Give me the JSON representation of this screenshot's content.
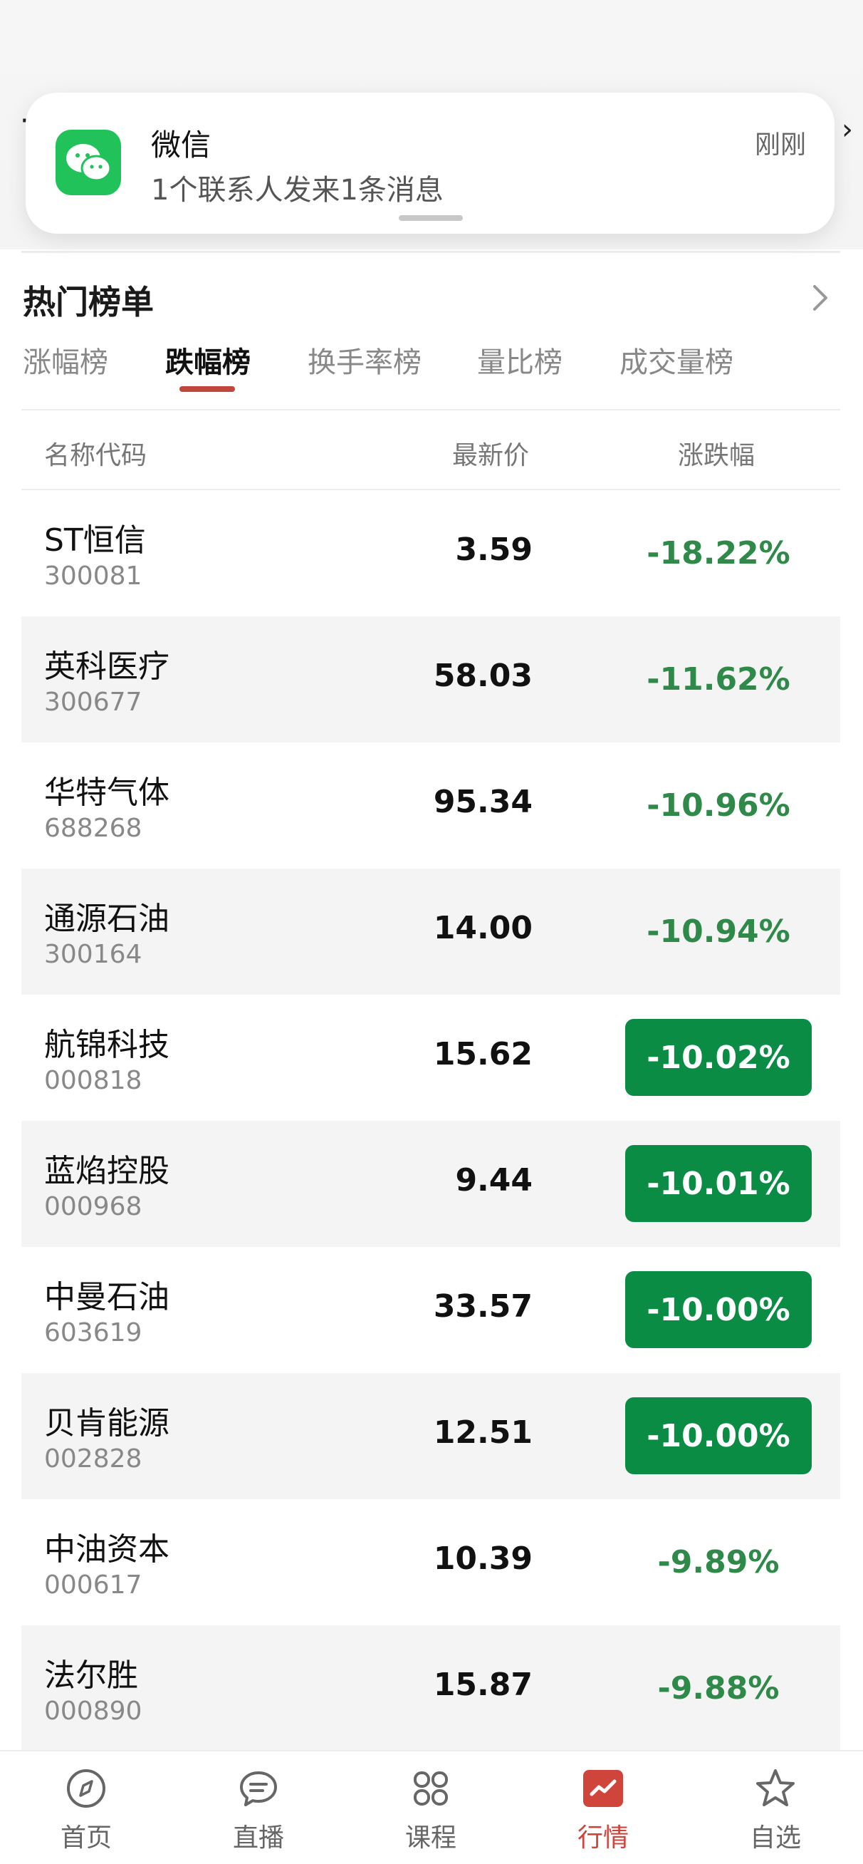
{
  "notification": {
    "app_name": "微信",
    "message": "1个联系人发来1条消息",
    "time": "刚刚"
  },
  "section": {
    "title": "热门榜单"
  },
  "tabs": [
    {
      "label": "涨幅榜",
      "active": false
    },
    {
      "label": "跌幅榜",
      "active": true
    },
    {
      "label": "换手率榜",
      "active": false
    },
    {
      "label": "量比榜",
      "active": false
    },
    {
      "label": "成交量榜",
      "active": false
    }
  ],
  "table": {
    "headers": {
      "name": "名称代码",
      "price": "最新价",
      "change": "涨跌幅"
    },
    "rows": [
      {
        "name": "ST恒信",
        "code": "300081",
        "price": "3.59",
        "change": "-18.22%",
        "badge": false
      },
      {
        "name": "英科医疗",
        "code": "300677",
        "price": "58.03",
        "change": "-11.62%",
        "badge": false
      },
      {
        "name": "华特气体",
        "code": "688268",
        "price": "95.34",
        "change": "-10.96%",
        "badge": false
      },
      {
        "name": "通源石油",
        "code": "300164",
        "price": "14.00",
        "change": "-10.94%",
        "badge": false
      },
      {
        "name": "航锦科技",
        "code": "000818",
        "price": "15.62",
        "change": "-10.02%",
        "badge": true
      },
      {
        "name": "蓝焰控股",
        "code": "000968",
        "price": "9.44",
        "change": "-10.01%",
        "badge": true
      },
      {
        "name": "中曼石油",
        "code": "603619",
        "price": "33.57",
        "change": "-10.00%",
        "badge": true
      },
      {
        "name": "贝肯能源",
        "code": "002828",
        "price": "12.51",
        "change": "-10.00%",
        "badge": true
      },
      {
        "name": "中油资本",
        "code": "000617",
        "price": "10.39",
        "change": "-9.89%",
        "badge": false
      },
      {
        "name": "法尔胜",
        "code": "000890",
        "price": "15.87",
        "change": "-9.88%",
        "badge": false
      }
    ]
  },
  "nav": [
    {
      "label": "首页",
      "icon": "compass-icon",
      "active": false
    },
    {
      "label": "直播",
      "icon": "chat-bubble-icon",
      "active": false
    },
    {
      "label": "课程",
      "icon": "grid-clover-icon",
      "active": false
    },
    {
      "label": "行情",
      "icon": "chart-icon",
      "active": true
    },
    {
      "label": "自选",
      "icon": "star-icon",
      "active": false
    }
  ],
  "colors": {
    "accent_red": "#d0453b",
    "down_green": "#2f8a4a",
    "badge_green": "#0a8c45",
    "wechat_green": "#22c25b"
  }
}
